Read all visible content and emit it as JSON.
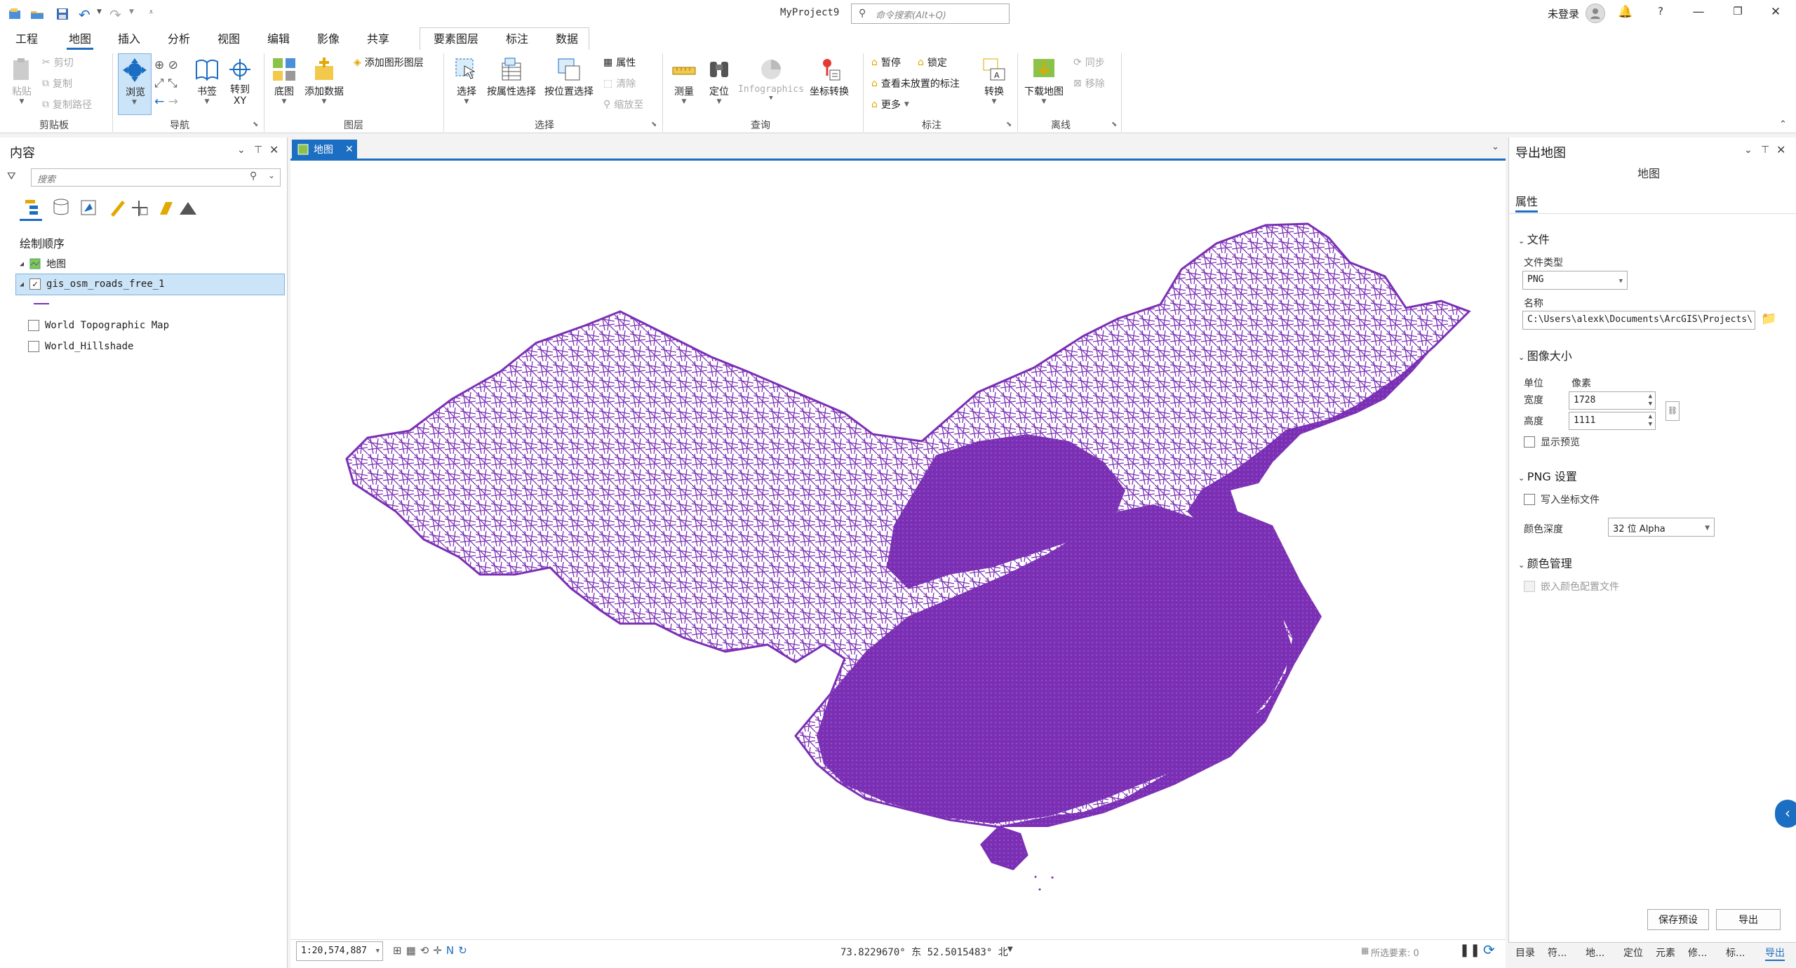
{
  "app": {
    "title": "MyProject9",
    "search_placeholder": "命令搜索(Alt+Q)",
    "login": "未登录",
    "help": "?",
    "qat_icons": [
      "new-project-icon",
      "open-project-icon",
      "save-icon",
      "undo-icon",
      "redo-icon",
      "customize-qat-icon"
    ]
  },
  "ribbon": {
    "tabs": [
      {
        "label": "工程",
        "active": false
      },
      {
        "label": "地图",
        "active": true
      },
      {
        "label": "插入",
        "active": false
      },
      {
        "label": "分析",
        "active": false
      },
      {
        "label": "视图",
        "active": false
      },
      {
        "label": "编辑",
        "active": false
      },
      {
        "label": "影像",
        "active": false
      },
      {
        "label": "共享",
        "active": false
      }
    ],
    "context_tabs": [
      "要素图层",
      "标注",
      "数据"
    ],
    "clipboard": {
      "paste": "粘贴",
      "cut": "剪切",
      "copy": "复制",
      "copy_path": "复制路径",
      "group": "剪贴板"
    },
    "navigate": {
      "explore": "浏览",
      "bookmarks": "书签",
      "goto_xy": "转到 XY",
      "group": "导航"
    },
    "layer": {
      "basemap": "底图",
      "add_data": "添加数据",
      "add_graphics": "添加图形图层",
      "group": "图层"
    },
    "selection": {
      "select": "选择",
      "by_attr": "按属性选择",
      "by_loc": "按位置选择",
      "attributes": "属性",
      "clear": "清除",
      "zoom_to": "缩放至",
      "group": "选择"
    },
    "inquiry": {
      "measure": "测量",
      "locate": "定位",
      "infographics": "Infographics",
      "coord_conv": "坐标转换",
      "group": "查询"
    },
    "labeling": {
      "pause": "暂停",
      "lock": "锁定",
      "unplaced": "查看未放置的标注",
      "more": "更多",
      "convert": "转换",
      "group": "标注"
    },
    "offline": {
      "download": "下载地图",
      "sync": "同步",
      "remove": "移除",
      "group": "离线"
    }
  },
  "contents": {
    "title": "内容",
    "search_placeholder": "搜索",
    "draw_order": "绘制顺序",
    "map_name": "地图",
    "layers": [
      {
        "name": "gis_osm_roads_free_1",
        "checked": true,
        "selected": true
      },
      {
        "name": "World Topographic Map",
        "checked": false,
        "selected": false
      },
      {
        "name": "World_Hillshade",
        "checked": false,
        "selected": false
      }
    ],
    "symbol_color": "#7b2fb5"
  },
  "map": {
    "tab_label": "地图",
    "scale": "1:20,574,887",
    "coordinates": "73.8229670° 东  52.5015483° 北",
    "selected_features": "所选要素: 0",
    "road_color": "#7b2fb5"
  },
  "export": {
    "title": "导出地图",
    "subtitle": "地图",
    "properties_tab": "属性",
    "file_section": "文件",
    "file_type_label": "文件类型",
    "file_type": "PNG",
    "name_label": "名称",
    "name_value": "C:\\Users\\alexk\\Documents\\ArcGIS\\Projects\\",
    "size_section": "图像大小",
    "unit_label": "单位",
    "unit_value": "像素",
    "width_label": "宽度",
    "width_value": "1728",
    "height_label": "高度",
    "height_value": "1111",
    "show_preview": "显示预览",
    "png_section": "PNG 设置",
    "write_world": "写入坐标文件",
    "color_depth_label": "颜色深度",
    "color_depth": "32 位 Alpha",
    "color_mgmt_section": "颜色管理",
    "embed_profile": "嵌入颜色配置文件",
    "save_preset": "保存预设",
    "export_btn": "导出"
  },
  "bottom_tabs": [
    "目录",
    "符...",
    "地...",
    "定位",
    "元素",
    "修...",
    "标...",
    "导出"
  ],
  "colors": {
    "accent": "#1b6ec2",
    "selection": "#cce4f7"
  }
}
